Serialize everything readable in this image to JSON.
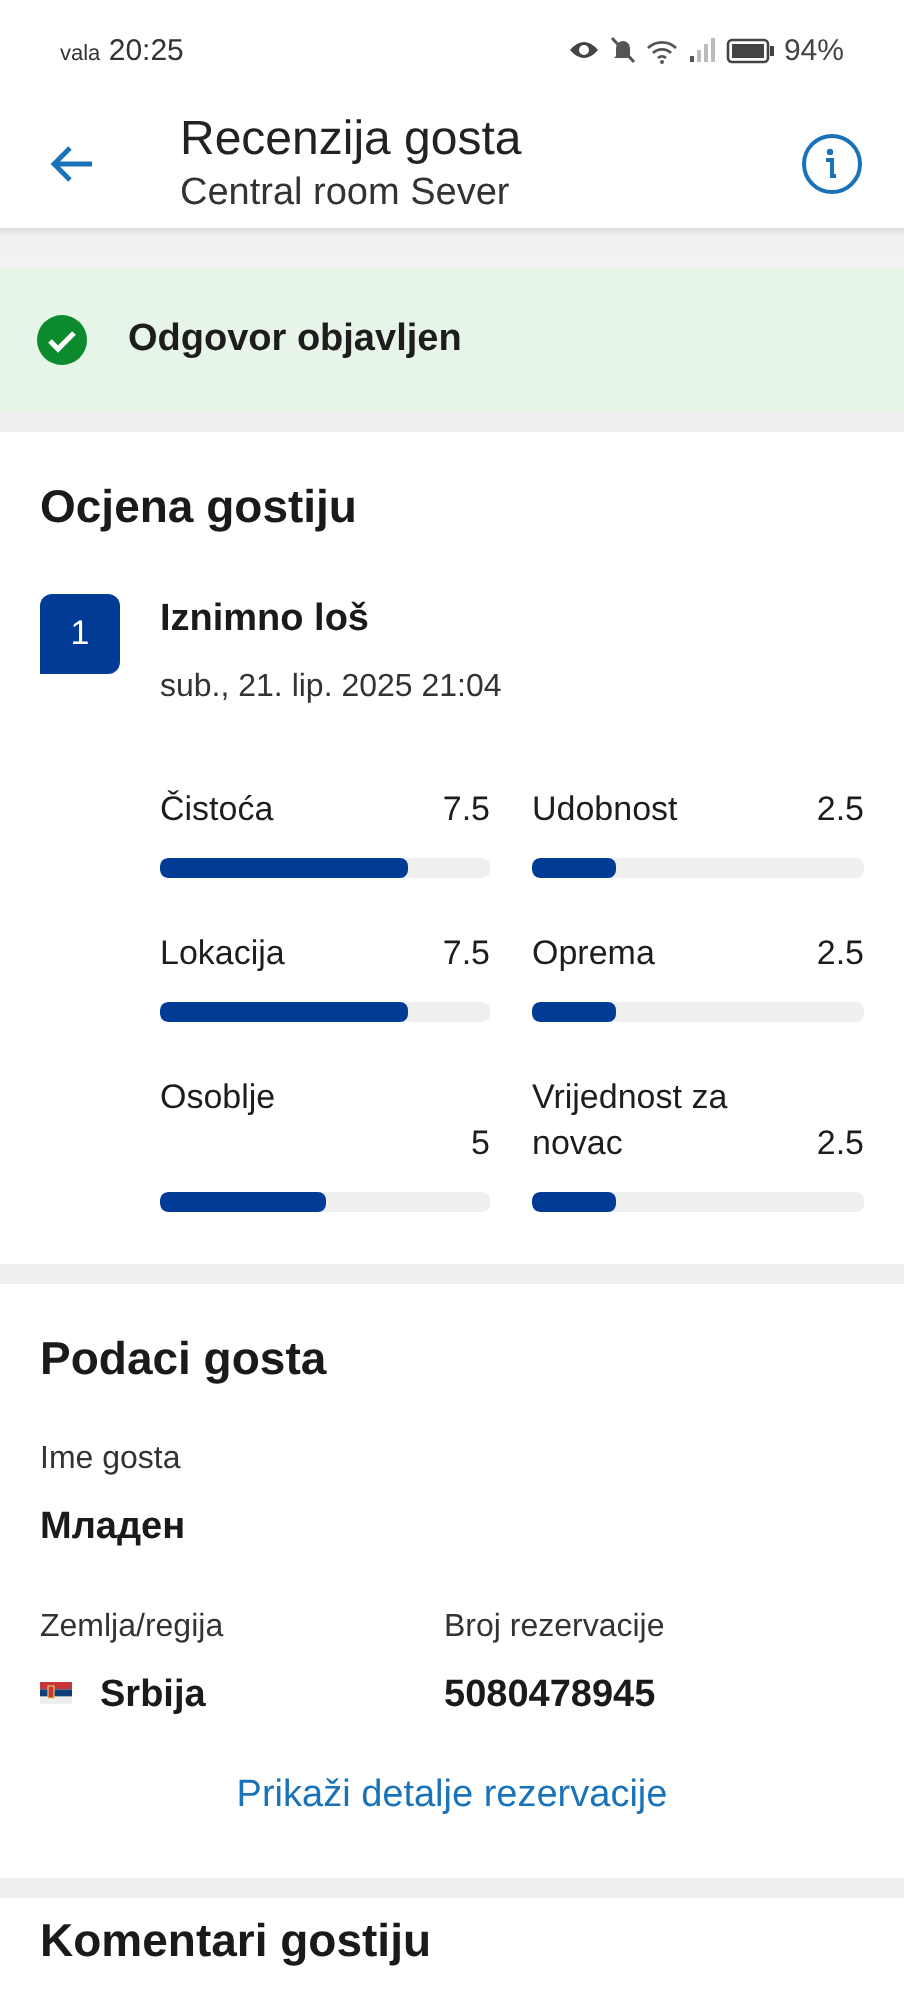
{
  "status_bar": {
    "carrier": "vala",
    "time": "20:25",
    "battery": "94%"
  },
  "header": {
    "title": "Recenzija gosta",
    "subtitle": "Central room Sever"
  },
  "banner": {
    "text": "Odgovor objavljen"
  },
  "rating": {
    "heading": "Ocjena gostiju",
    "score": "1",
    "verdict": "Iznimno loš",
    "date": "sub., 21. lip. 2025 21:04",
    "categories": [
      {
        "name": "Čistoća",
        "value": "7.5",
        "level": 0.75
      },
      {
        "name": "Udobnost",
        "value": "2.5",
        "level": 0.25
      },
      {
        "name": "Lokacija",
        "value": "7.5",
        "level": 0.75
      },
      {
        "name": "Oprema",
        "value": "2.5",
        "level": 0.25
      },
      {
        "name": "Osoblje",
        "value": "5",
        "level": 0.5
      },
      {
        "name": "Vrijednost za novac",
        "value": "2.5",
        "level": 0.25
      }
    ]
  },
  "guest": {
    "heading": "Podaci gosta",
    "name_label": "Ime gosta",
    "name": "Младен",
    "country_label": "Zemlja/regija",
    "country": "Srbija",
    "booking_label": "Broj rezervacije",
    "booking": "5080478945",
    "link": "Prikaži detalje rezervacije"
  },
  "comments": {
    "heading": "Komentari gostiju"
  }
}
